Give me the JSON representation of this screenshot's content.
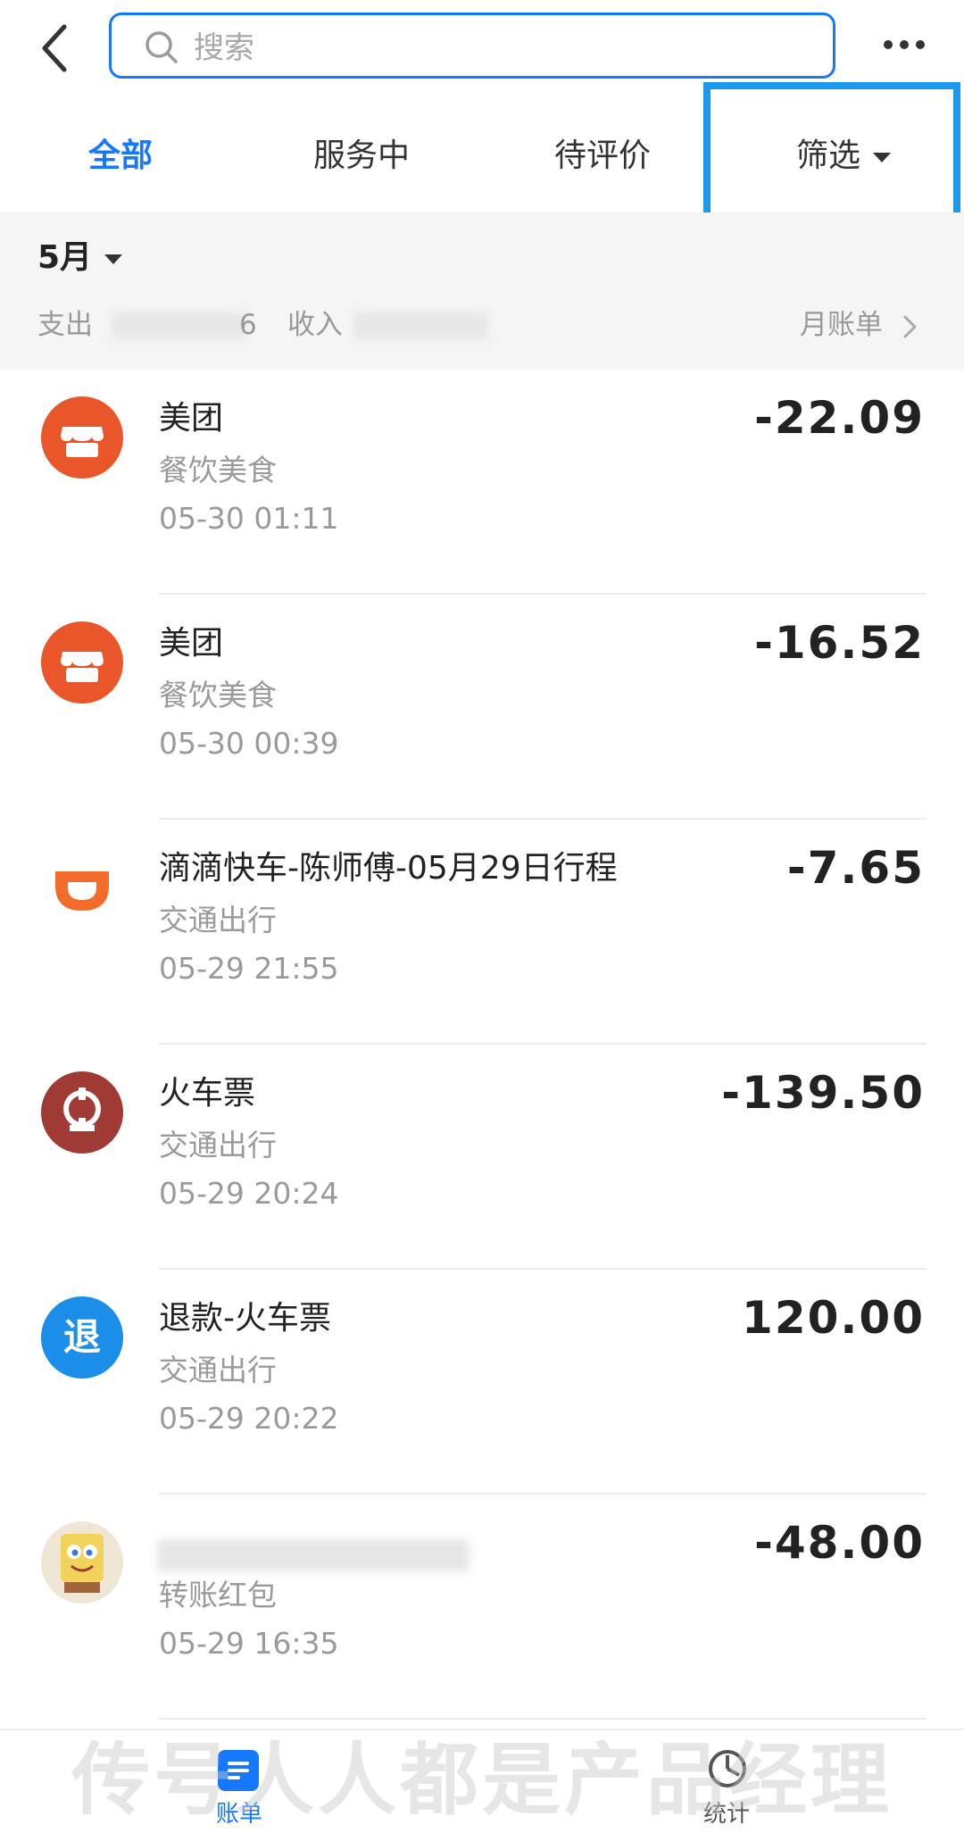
{
  "header": {
    "search_placeholder": "搜索",
    "back_icon": "chevron-left-icon",
    "more_icon": "more-horizontal-icon"
  },
  "tabs": [
    {
      "label": "全部",
      "active": true
    },
    {
      "label": "服务中",
      "active": false
    },
    {
      "label": "待评价",
      "active": false
    },
    {
      "label": "筛选",
      "active": false
    }
  ],
  "month": {
    "label": "5月",
    "expense_label": "支出",
    "expense_tail": "6",
    "income_label": "收入",
    "monthly_bill": "月账单"
  },
  "transactions": [
    {
      "name": "美团",
      "category": "餐饮美食",
      "time": "05-30  01:11",
      "amount": "-22.09",
      "icon": "meituan-store-icon",
      "icon_color": "#e8562a"
    },
    {
      "name": "美团",
      "category": "餐饮美食",
      "time": "05-30  00:39",
      "amount": "-16.52",
      "icon": "meituan-store-icon",
      "icon_color": "#e8562a"
    },
    {
      "name": "滴滴快车-陈师傅-05月29日行程",
      "category": "交通出行",
      "time": "05-29  21:55",
      "amount": "-7.65",
      "icon": "didi-logo-icon",
      "icon_color": "#f26b2a"
    },
    {
      "name": "火车票",
      "category": "交通出行",
      "time": "05-29  20:24",
      "amount": "-139.50",
      "icon": "railway-logo-icon",
      "icon_color": "#a03a34"
    },
    {
      "name": "退款-火车票",
      "category": "交通出行",
      "time": "05-29  20:22",
      "amount": "120.00",
      "icon": "refund-icon",
      "icon_color": "#1a8ee8",
      "icon_text": "退"
    },
    {
      "name": "",
      "category": "转账红包",
      "time": "05-29  16:35",
      "amount": "-48.00",
      "icon": "user-avatar-icon",
      "icon_color": "#f2d35a"
    }
  ],
  "bottom_nav": {
    "bill_label": "账单",
    "stats_label": "统计",
    "watermark": "传号人人都是产品经理"
  },
  "colors": {
    "accent": "#1677ff",
    "highlight_box": "#1a99ee"
  }
}
